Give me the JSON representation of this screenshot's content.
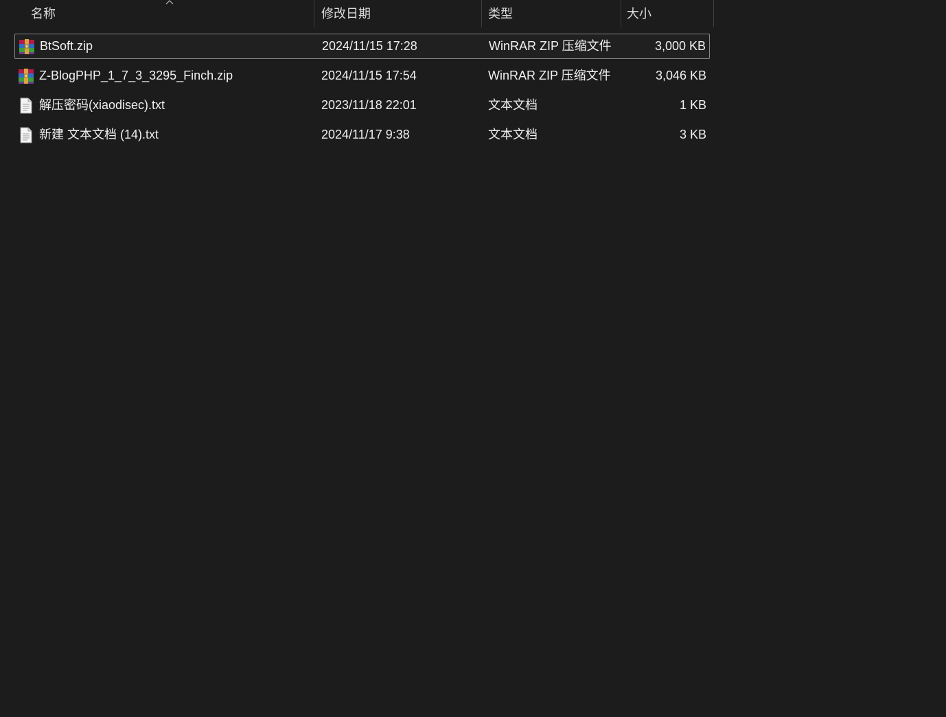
{
  "header": {
    "columns": {
      "name": "名称",
      "date": "修改日期",
      "type": "类型",
      "size": "大小"
    },
    "sort_icon": "chevron-up-icon"
  },
  "files": [
    {
      "name": "BtSoft.zip",
      "date": "2024/11/15 17:28",
      "type": "WinRAR ZIP 压缩文件",
      "size": "3,000 KB",
      "icon": "winrar-zip-icon",
      "selected": true
    },
    {
      "name": "Z-BlogPHP_1_7_3_3295_Finch.zip",
      "date": "2024/11/15 17:54",
      "type": "WinRAR ZIP 压缩文件",
      "size": "3,046 KB",
      "icon": "winrar-zip-icon",
      "selected": false
    },
    {
      "name": "解压密码(xiaodisec).txt",
      "date": "2023/11/18 22:01",
      "type": "文本文档",
      "size": "1 KB",
      "icon": "text-file-icon",
      "selected": false
    },
    {
      "name": "新建 文本文档 (14).txt",
      "date": "2024/11/17 9:38",
      "type": "文本文档",
      "size": "3 KB",
      "icon": "text-file-icon",
      "selected": false
    }
  ],
  "colors": {
    "background": "#1c1c1c",
    "text": "#f0f0f0",
    "selection_border": "#8a8a8a",
    "divider": "#3e3e3e"
  }
}
